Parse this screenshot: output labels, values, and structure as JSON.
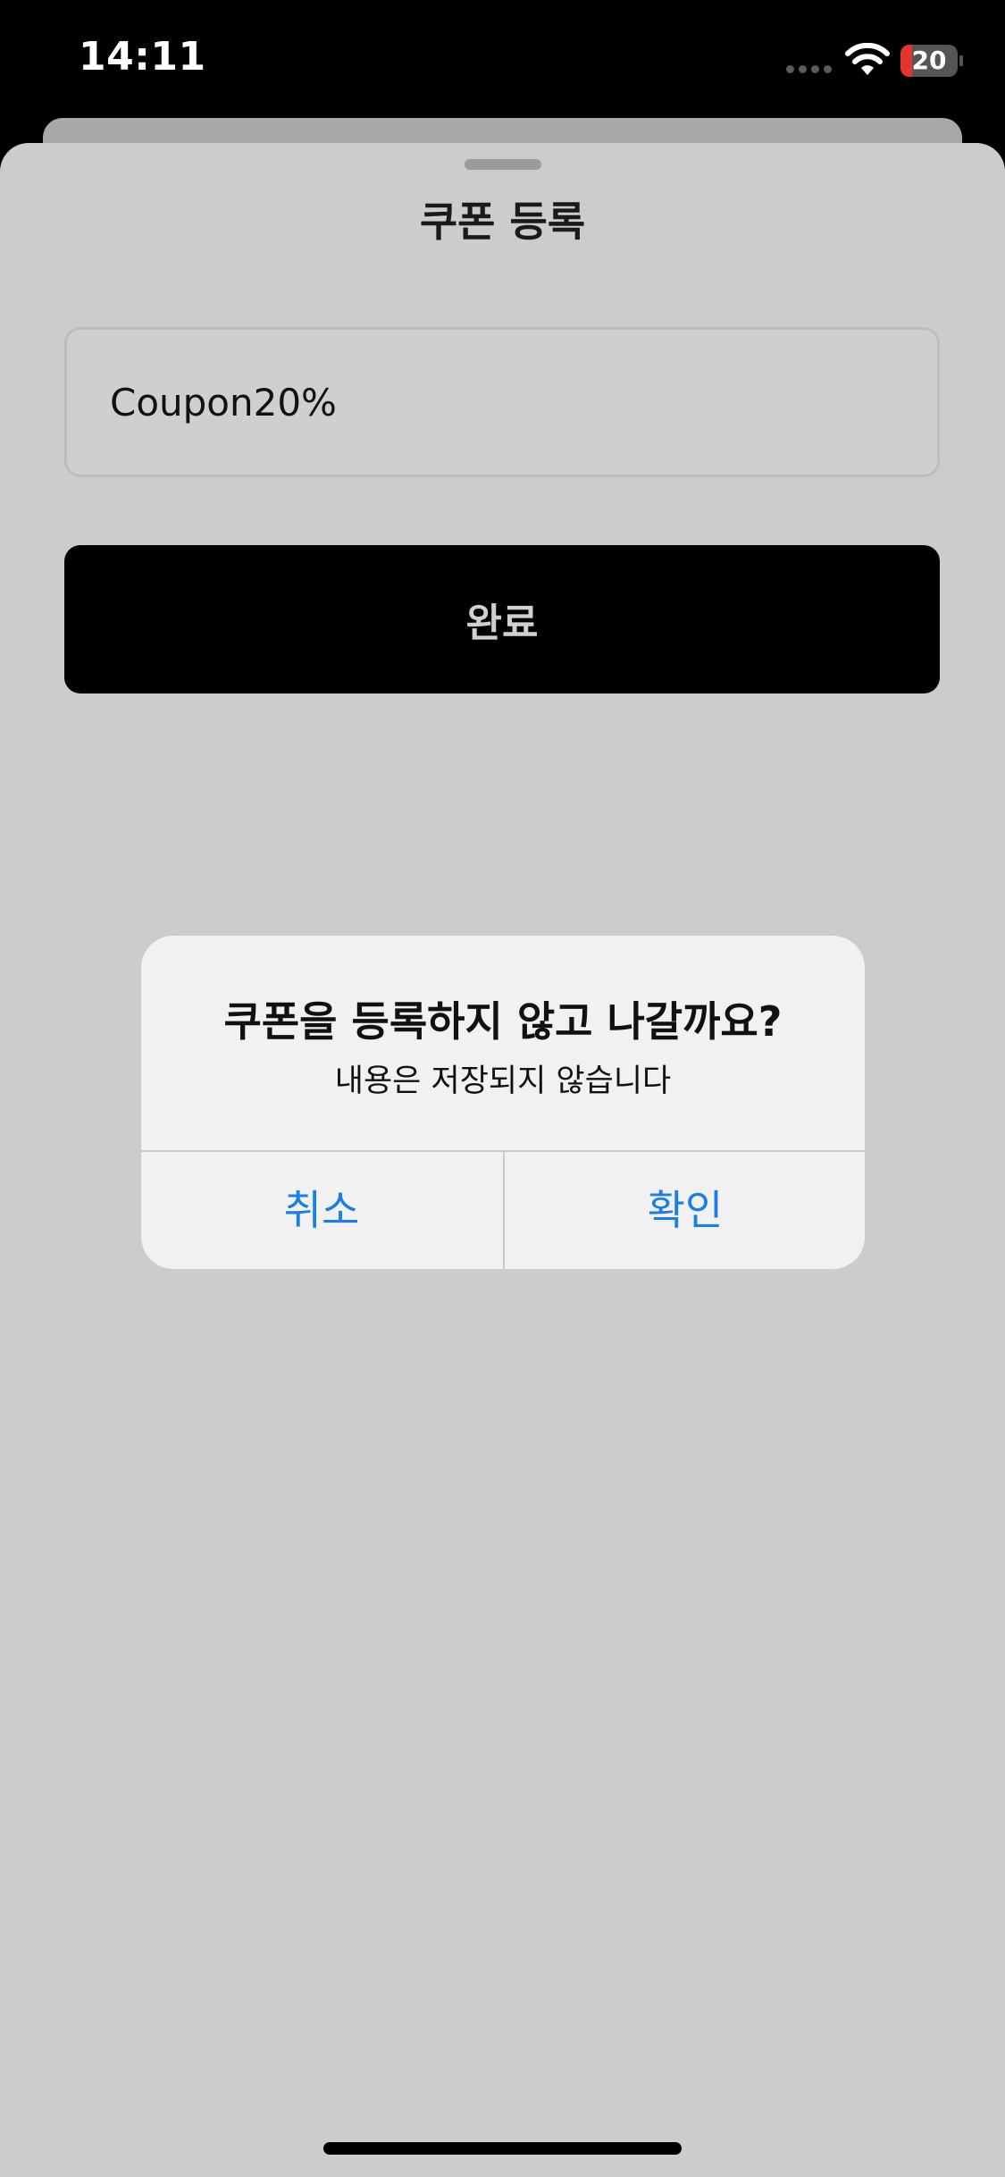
{
  "status_bar": {
    "time": "14:11",
    "battery_level": "20",
    "battery_fraction": 0.2,
    "battery_color": "#e5352f",
    "icons": [
      "signal-dots-icon",
      "wifi-icon",
      "battery-icon"
    ]
  },
  "sheet": {
    "title": "쿠폰 등록",
    "coupon_input_value": "Coupon20%",
    "done_label": "완료"
  },
  "alert": {
    "title": "쿠폰을 등록하지 않고 나갈까요?",
    "message": "내용은 저장되지 않습니다",
    "cancel_label": "취소",
    "confirm_label": "확인",
    "accent_color": "#1a7ee6"
  }
}
